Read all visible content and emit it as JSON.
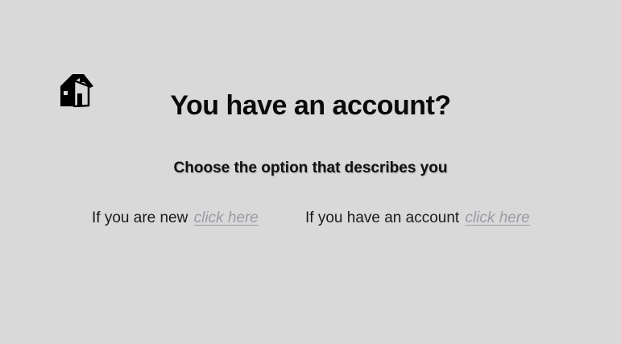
{
  "home": {
    "icon": "house-icon"
  },
  "page": {
    "title": "You have an account?",
    "subtitle": "Choose the option that describes you"
  },
  "options": {
    "new_user": {
      "text": "If you are new",
      "link_label": "click here"
    },
    "existing_user": {
      "text": "If you have an account",
      "link_label": "click here"
    }
  },
  "colors": {
    "background": "#d9d9d9",
    "link": "#9a9ca6",
    "text": "#111111"
  }
}
